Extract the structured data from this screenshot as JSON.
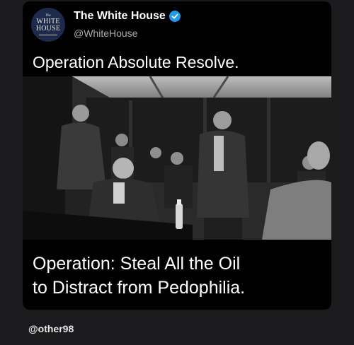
{
  "post": {
    "account_name": "The White House",
    "handle": "@WhiteHouse",
    "verified": true,
    "verified_color": "#1d9bf0",
    "text": "Operation Absolute Resolve.",
    "avatar": {
      "seal_small": "The",
      "seal_line1": "WHITE",
      "seal_line2": "HOUSE"
    },
    "image": {
      "description_icon": "photo"
    }
  },
  "caption": {
    "line1": "Operation: Steal All the Oil",
    "line2": "to Distract from Pedophilia."
  },
  "watermark": "@other98"
}
